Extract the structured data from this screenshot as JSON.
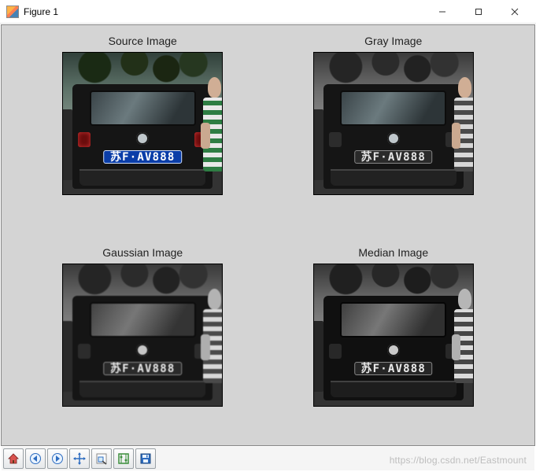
{
  "window": {
    "title": "Figure 1"
  },
  "plate_text": "苏F·AV888",
  "subplots": [
    {
      "title": "Source Image",
      "variant": "color"
    },
    {
      "title": "Gray Image",
      "variant": "gray"
    },
    {
      "title": "Gaussian Image",
      "variant": "gauss"
    },
    {
      "title": "Median Image",
      "variant": "median"
    }
  ],
  "toolbar": {
    "buttons": [
      {
        "name": "home-button",
        "icon": "home"
      },
      {
        "name": "back-button",
        "icon": "back"
      },
      {
        "name": "forward-button",
        "icon": "forward"
      },
      {
        "name": "pan-button",
        "icon": "pan"
      },
      {
        "name": "zoom-button",
        "icon": "zoom"
      },
      {
        "name": "configure-button",
        "icon": "configure"
      },
      {
        "name": "save-button",
        "icon": "save"
      }
    ]
  },
  "watermark": "https://blog.csdn.net/Eastmount"
}
